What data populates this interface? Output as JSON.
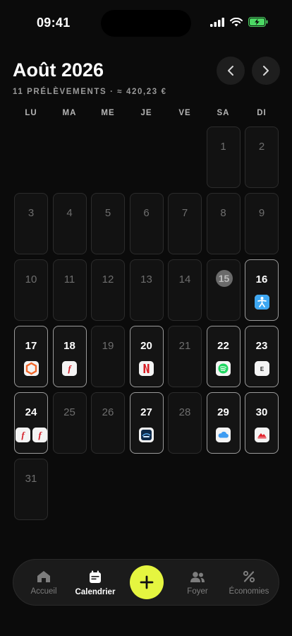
{
  "status_bar": {
    "time": "09:41",
    "icons": [
      "signal-icon",
      "wifi-icon",
      "battery-charging-icon"
    ]
  },
  "header": {
    "title": "Août 2026",
    "subtitle": "11 PRÉLÈVEMENTS · ≈ 420,23 €",
    "prev_icon": "chevron-left-icon",
    "next_icon": "chevron-right-icon"
  },
  "weekdays": [
    "LU",
    "MA",
    "ME",
    "JE",
    "VE",
    "SA",
    "DI"
  ],
  "calendar": {
    "leading_blanks": 5,
    "today": "15",
    "days": [
      {
        "day": "1",
        "icons": []
      },
      {
        "day": "2",
        "icons": []
      },
      {
        "day": "3",
        "icons": []
      },
      {
        "day": "4",
        "icons": []
      },
      {
        "day": "5",
        "icons": []
      },
      {
        "day": "6",
        "icons": []
      },
      {
        "day": "7",
        "icons": []
      },
      {
        "day": "8",
        "icons": []
      },
      {
        "day": "9",
        "icons": []
      },
      {
        "day": "10",
        "icons": []
      },
      {
        "day": "11",
        "icons": []
      },
      {
        "day": "12",
        "icons": []
      },
      {
        "day": "13",
        "icons": []
      },
      {
        "day": "14",
        "icons": []
      },
      {
        "day": "15",
        "icons": []
      },
      {
        "day": "16",
        "icons": [
          "fitness-app-icon"
        ]
      },
      {
        "day": "17",
        "icons": [
          "hexagon-app-icon"
        ]
      },
      {
        "day": "18",
        "icons": [
          "free-f-app-icon"
        ]
      },
      {
        "day": "19",
        "icons": []
      },
      {
        "day": "20",
        "icons": [
          "netflix-icon"
        ]
      },
      {
        "day": "21",
        "icons": []
      },
      {
        "day": "22",
        "icons": [
          "spotify-icon"
        ]
      },
      {
        "day": "23",
        "icons": [
          "e-app-icon"
        ]
      },
      {
        "day": "24",
        "icons": [
          "free-f-app-icon",
          "free-f-app-icon"
        ]
      },
      {
        "day": "25",
        "icons": []
      },
      {
        "day": "26",
        "icons": []
      },
      {
        "day": "27",
        "icons": [
          "disney-plus-icon"
        ]
      },
      {
        "day": "28",
        "icons": []
      },
      {
        "day": "29",
        "icons": [
          "icloud-icon"
        ]
      },
      {
        "day": "30",
        "icons": [
          "red-app-icon"
        ]
      },
      {
        "day": "31",
        "icons": []
      }
    ]
  },
  "tabbar": {
    "tabs": [
      {
        "label": "Accueil",
        "icon": "home-icon",
        "active": false
      },
      {
        "label": "Calendrier",
        "icon": "calendar-icon",
        "active": true
      },
      {
        "label": "Foyer",
        "icon": "people-icon",
        "active": false
      },
      {
        "label": "Économies",
        "icon": "percent-icon",
        "active": false
      }
    ],
    "fab_icon": "plus-icon"
  },
  "colors": {
    "accent": "#E5F540",
    "background": "#0B0B0B"
  }
}
